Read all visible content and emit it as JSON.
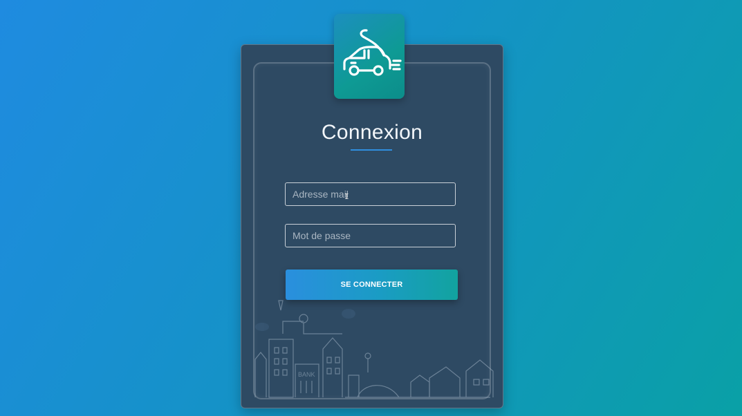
{
  "login": {
    "title": "Connexion",
    "email_placeholder": "Adresse mail",
    "password_placeholder": "Mot de passe",
    "submit_label": "SE CONNECTER"
  },
  "illustration": {
    "bank_label": "BANK",
    "logo_icon": "car-speed-icon"
  },
  "colors": {
    "background_start": "#1f8be0",
    "background_end": "#0aa0a6",
    "card": "#2e4a63",
    "accent": "#2f8fe0"
  }
}
